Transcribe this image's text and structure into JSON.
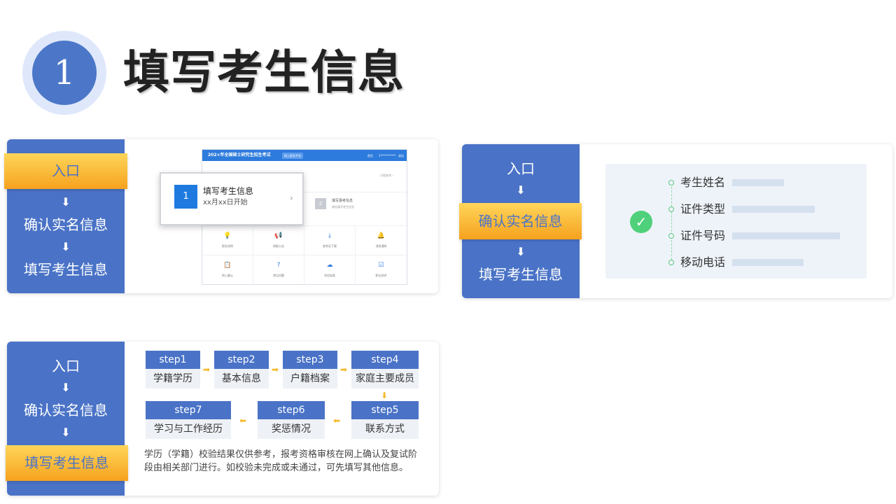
{
  "header": {
    "number": "1",
    "title": "填写考生信息"
  },
  "flow": {
    "entry": "入口",
    "confirm": "确认实名信息",
    "fill": "填写考生信息",
    "arrow": "⬇"
  },
  "screenshot": {
    "topbar_title": "202×年全国硕士研究生招生考试",
    "topbar_btn": "网上报名平台",
    "topbar_link1": "首页",
    "topbar_link2": "1***********",
    "topbar_link3": "退出",
    "row1_right": "日程安排 ›",
    "card_index": "1",
    "card_title": "填写考生信息",
    "card_subtitle": "xx月xx日开始",
    "card_chevron": "›",
    "card2_index": "2",
    "card2_title": "填写报考信息",
    "card2_subtitle": "请先填写考生信息",
    "grid": [
      {
        "icon": "bulb-icon",
        "glyph": "💡",
        "label": "报名须知"
      },
      {
        "icon": "megaphone-icon",
        "glyph": "📢",
        "label": "网报公告"
      },
      {
        "icon": "download-icon",
        "glyph": "⤓",
        "label": "准考证下载"
      },
      {
        "icon": "bell-icon",
        "glyph": "🔔",
        "label": "消息通知"
      },
      {
        "icon": "clipboard-icon",
        "glyph": "📋",
        "label": "网上确认"
      },
      {
        "icon": "question-icon",
        "glyph": "?",
        "label": "常见问题"
      },
      {
        "icon": "cloud-icon",
        "glyph": "☁",
        "label": "学信档案"
      },
      {
        "icon": "checklist-icon",
        "glyph": "☑",
        "label": "职业测评"
      }
    ]
  },
  "form": {
    "check": "✓",
    "fields": [
      "考生姓名",
      "证件类型",
      "证件号码",
      "移动电话"
    ]
  },
  "steps": [
    {
      "step": "step1",
      "label": "学籍学历"
    },
    {
      "step": "step2",
      "label": "基本信息"
    },
    {
      "step": "step3",
      "label": "户籍档案"
    },
    {
      "step": "step4",
      "label": "家庭主要成员"
    },
    {
      "step": "step5",
      "label": "联系方式"
    },
    {
      "step": "step6",
      "label": "奖惩情况"
    },
    {
      "step": "step7",
      "label": "学习与工作经历"
    }
  ],
  "note": "学历（学籍）校验结果仅供参考，报考资格审核在网上确认及复试阶段由相关部门进行。如校验未完成或未通过，可先填写其他信息。",
  "colors": {
    "side": "#4a73c7",
    "highlight": "#f6a21e",
    "check": "#4fd07a",
    "arrow": "#f5b92a"
  }
}
